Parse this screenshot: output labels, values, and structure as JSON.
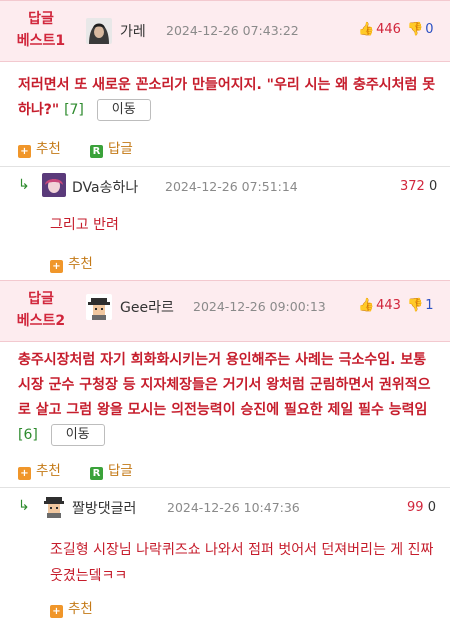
{
  "comments": [
    {
      "badge_line1": "답글",
      "badge_line2": "베스트1",
      "nickname": "가레",
      "datetime": "2024-12-26 07:43:22",
      "up_count": "446",
      "down_count": "0",
      "text": "저러면서 또 새로운 꼰소리가 만들어지지. \"우리 시는 왜 충주시처럼 못 하나?\"",
      "reply_count": "[7]",
      "move_label": "이동",
      "recommend_label": "추천",
      "reply_label": "답글",
      "reply": {
        "nickname": "DVa송하나",
        "datetime": "2024-12-26 07:51:14",
        "up_count": "372",
        "down_count": "0",
        "text": "그리고 반려",
        "recommend_label": "추천"
      }
    },
    {
      "badge_line1": "답글",
      "badge_line2": "베스트2",
      "nickname": "Gee라르",
      "datetime": "2024-12-26 09:00:13",
      "up_count": "443",
      "down_count": "1",
      "text": "충주시장처럼 자기 희화화시키는거 용인해주는 사례는 극소수임. 보통 시장 군수 구청장 등 지자체장들은 거기서 왕처럼 군림하면서 권위적으로 살고 그럼 왕을 모시는 의전능력이 승진에 필요한 제일 필수 능력임",
      "reply_count": "[6]",
      "move_label": "이동",
      "recommend_label": "추천",
      "reply_label": "답글",
      "reply": {
        "nickname": "짤방댓글러",
        "datetime": "2024-12-26 10:47:36",
        "up_count": "99",
        "down_count": "0",
        "text": "조길형 시장님 나락퀴즈쇼 나와서 점퍼 벗어서 던져버리는 게 진짜 웃겼는뎈ㅋㅋ",
        "recommend_label": "추천"
      }
    }
  ],
  "colors": {
    "best_red": "#d1263c",
    "best_bg": "#fdecef",
    "reply_green": "#2e8b2e",
    "recommend_orange": "#f0962a",
    "down_blue": "#2b51c4"
  }
}
